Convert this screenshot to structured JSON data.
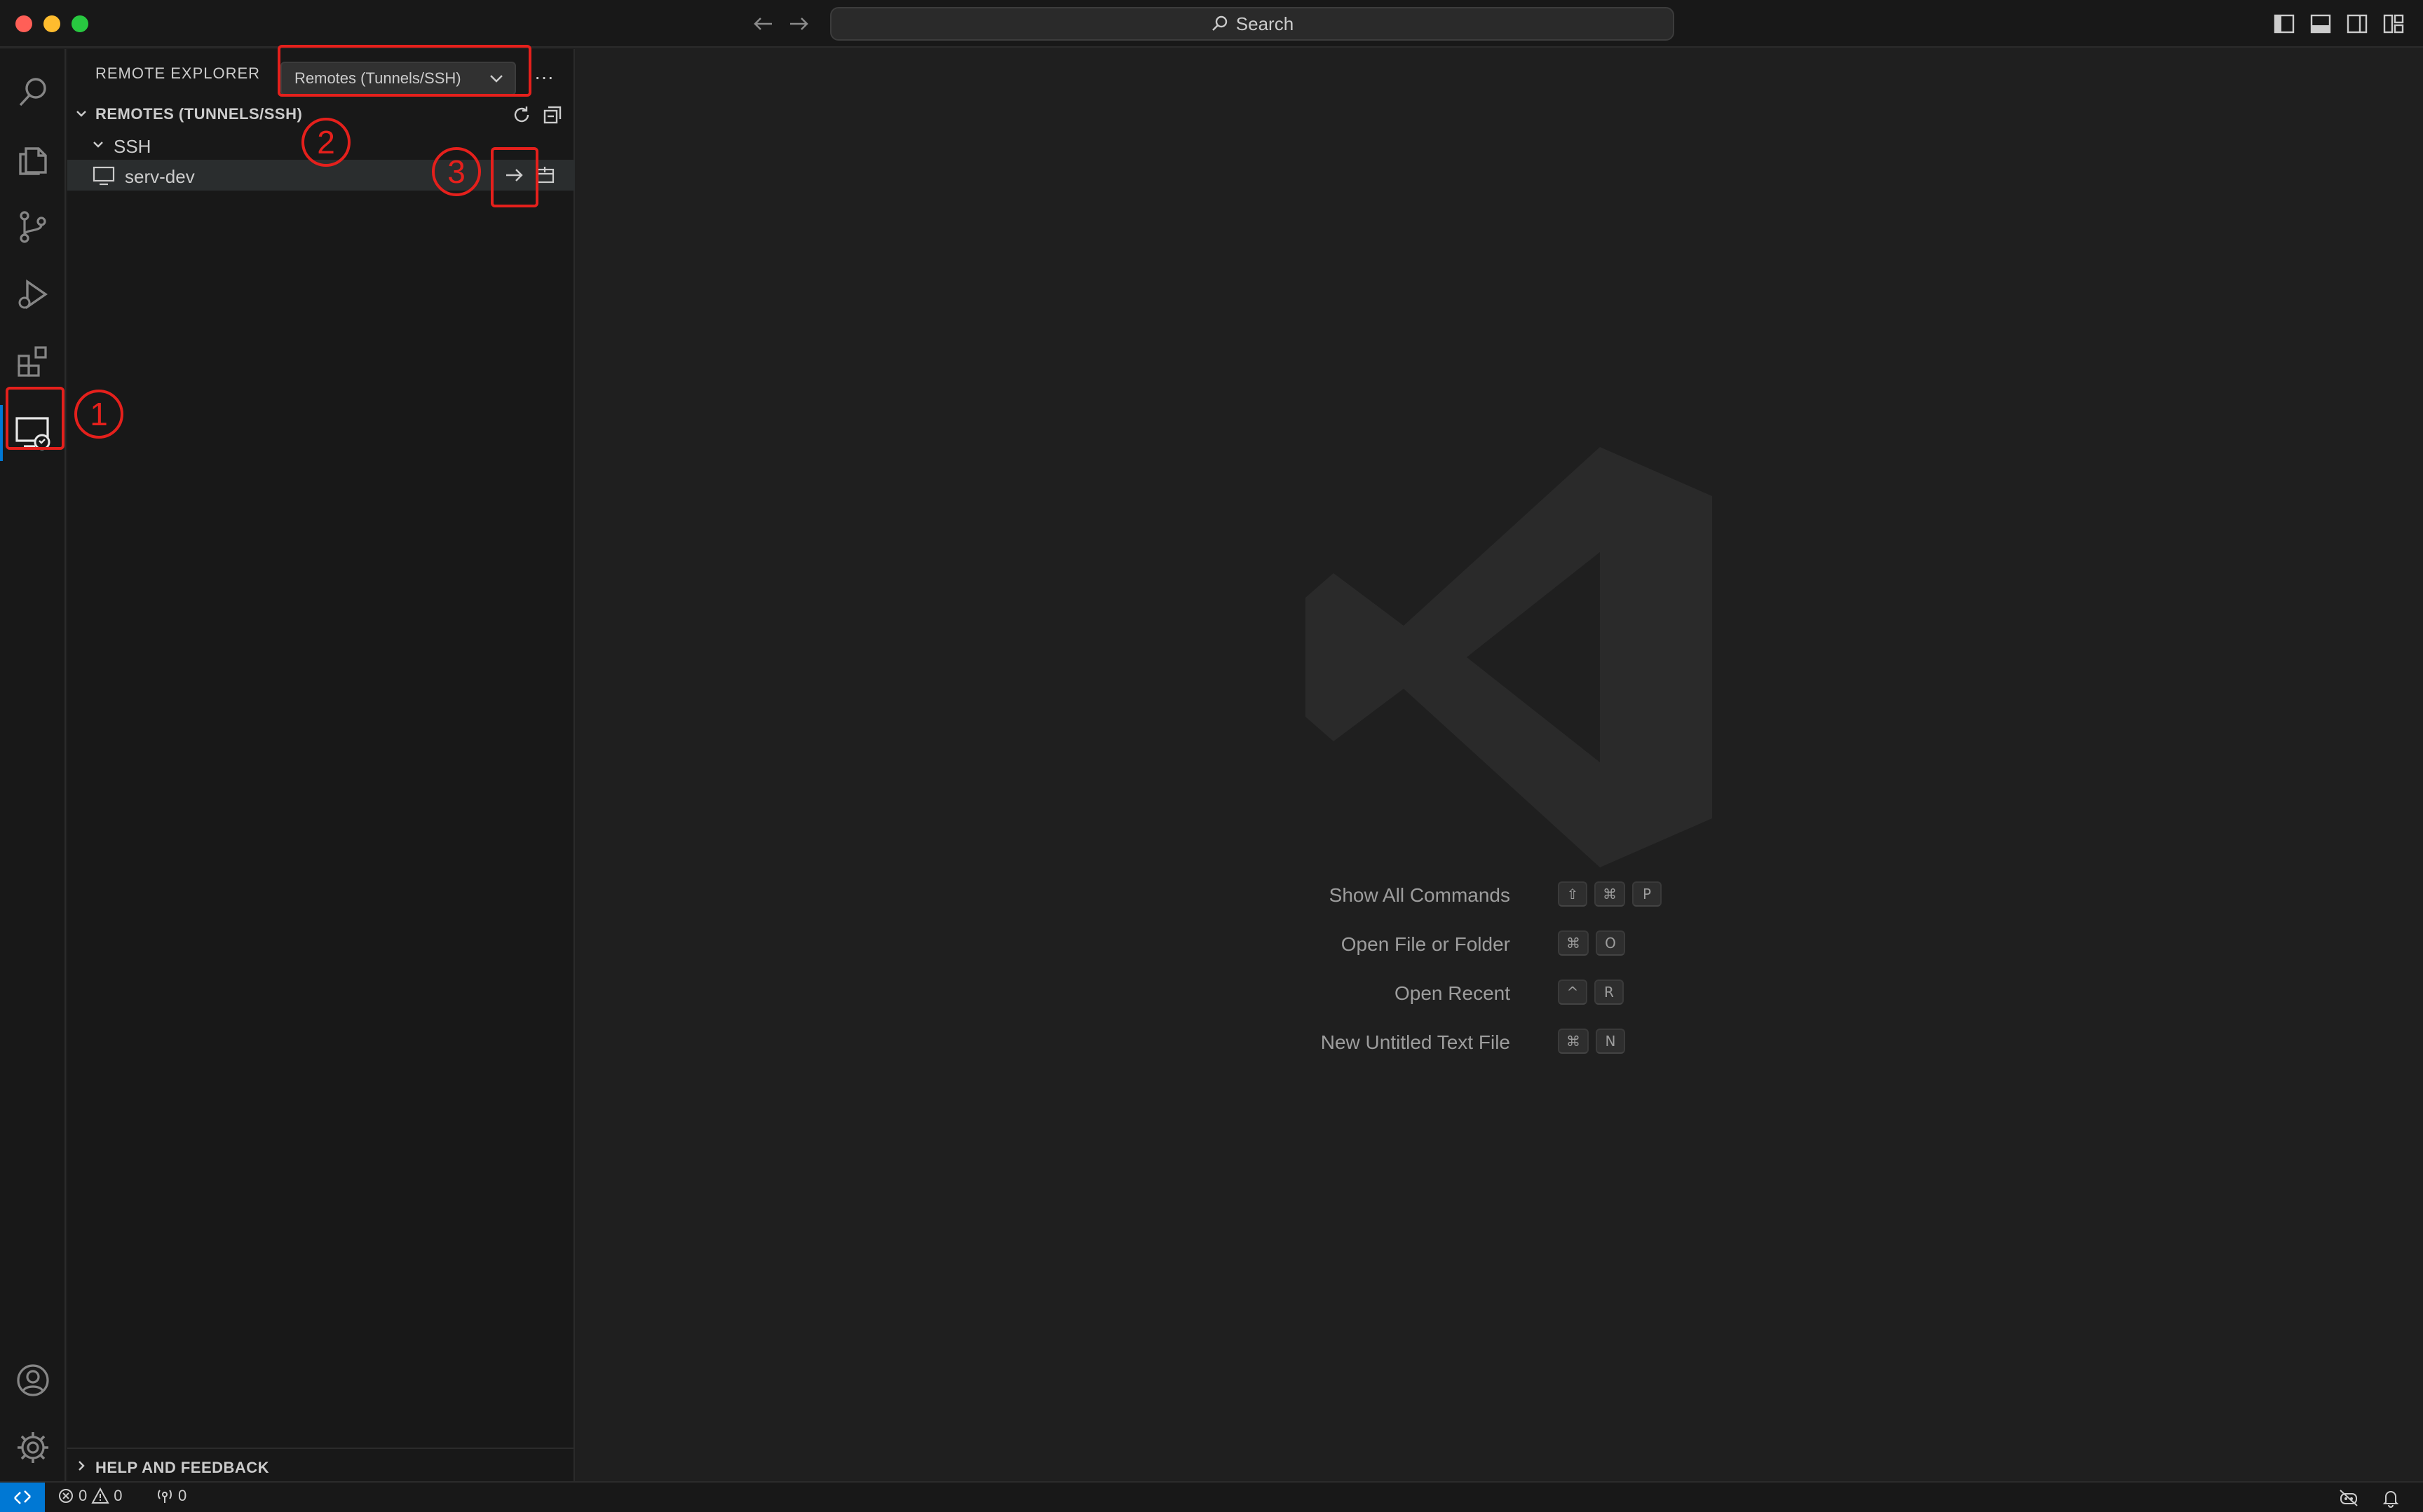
{
  "titlebar": {
    "search_label": "Search"
  },
  "sidebar": {
    "title": "REMOTE EXPLORER",
    "dropdown_value": "Remotes (Tunnels/SSH)",
    "more_label": "···",
    "section_label": "REMOTES (TUNNELS/SSH)",
    "group_label": "SSH",
    "host_label": "serv-dev",
    "help_label": "HELP AND FEEDBACK"
  },
  "editor": {
    "shortcuts": [
      {
        "label": "Show All Commands",
        "keys": [
          "⇧",
          "⌘",
          "P"
        ]
      },
      {
        "label": "Open File or Folder",
        "keys": [
          "⌘",
          "O"
        ]
      },
      {
        "label": "Open Recent",
        "keys": [
          "^",
          "R"
        ]
      },
      {
        "label": "New Untitled Text File",
        "keys": [
          "⌘",
          "N"
        ]
      }
    ]
  },
  "statusbar": {
    "errors": "0",
    "warnings": "0",
    "ports": "0"
  },
  "annotations": {
    "one": "1",
    "two": "2",
    "three": "3",
    "color": "#e5201c"
  },
  "colors": {
    "accent": "#0078d4",
    "background": "#1f1f1f",
    "sidebar": "#181818"
  },
  "icons": {
    "activity": [
      "search-icon",
      "explorer-icon",
      "source-control-icon",
      "run-debug-icon",
      "extensions-icon",
      "remote-explorer-icon",
      "account-icon",
      "settings-gear-icon"
    ]
  }
}
